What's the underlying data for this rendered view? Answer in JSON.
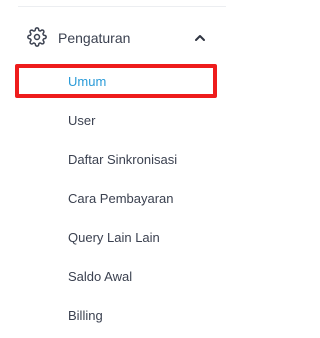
{
  "sidebar": {
    "section": {
      "icon": "gear-icon",
      "label": "Pengaturan",
      "expanded_icon": "chevron-up-icon"
    },
    "items": [
      {
        "label": "Umum",
        "active": true
      },
      {
        "label": "User"
      },
      {
        "label": "Daftar Sinkronisasi"
      },
      {
        "label": "Cara Pembayaran"
      },
      {
        "label": "Query Lain Lain"
      },
      {
        "label": "Saldo Awal"
      },
      {
        "label": "Billing"
      }
    ]
  },
  "colors": {
    "text": "#3b4150",
    "active_text": "#2a9bd8",
    "highlight_border": "#ee1c1c",
    "divider": "#eceef1"
  }
}
